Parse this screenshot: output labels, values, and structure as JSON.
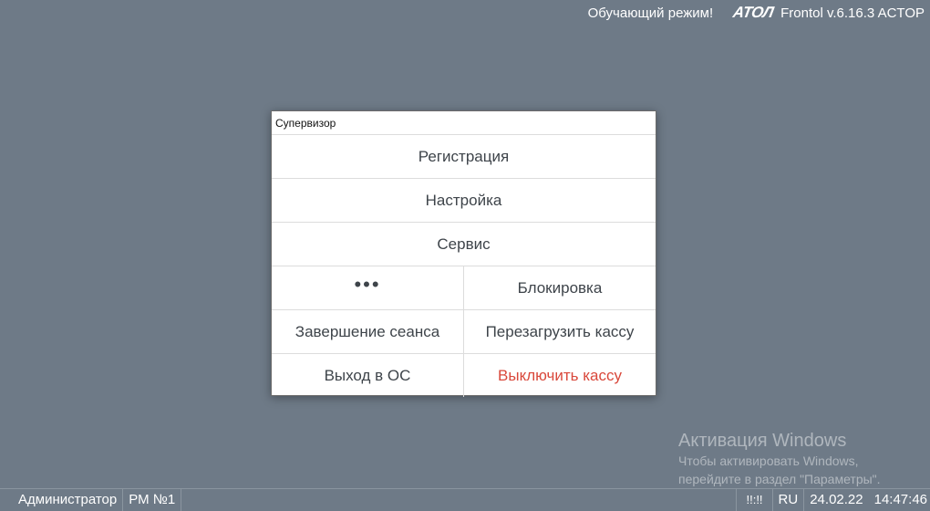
{
  "topbar": {
    "mode": "Обучающий режим!",
    "logo": "ATOЛ",
    "version": "Frontol v.6.16.3 ACTOP"
  },
  "dialog": {
    "title": "Супервизор",
    "registration": "Регистрация",
    "settings": "Настройка",
    "service": "Сервис",
    "more": "•••",
    "lock": "Блокировка",
    "end_session": "Завершение сеанса",
    "restart_pos": "Перезагрузить кассу",
    "exit_os": "Выход в ОС",
    "shutdown_pos": "Выключить кассу"
  },
  "watermark": {
    "title": "Активация Windows",
    "line1": "Чтобы активировать Windows,",
    "line2": "перейдите в раздел \"Параметры\"."
  },
  "statusbar": {
    "user": "Администратор",
    "workstation": "РМ №1",
    "indicator": "!!:!!",
    "language": "RU",
    "date": "24.02.22",
    "time": "14:47:46"
  },
  "colors": {
    "background": "#6e7a87",
    "danger": "#d9483b"
  }
}
